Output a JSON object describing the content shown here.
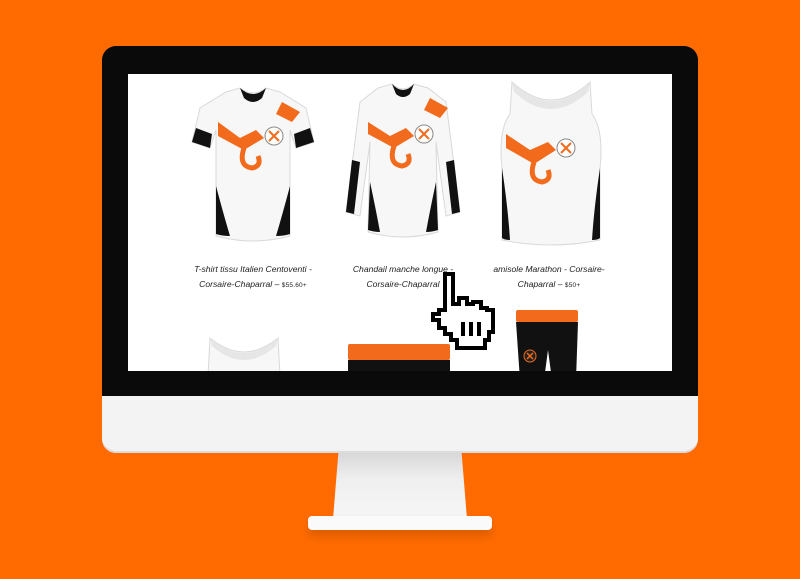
{
  "colors": {
    "background": "#ff6b00",
    "accent": "#f26a1b",
    "garment": "#f7f7f7",
    "trim": "#111111"
  },
  "products": [
    {
      "name_line1": "T-shirt tissu Italien Centoventi -",
      "name_line2": "Corsaire-Chaparral",
      "separator": "–",
      "price": "$55.60+"
    },
    {
      "name_line1": "Chandail manche longue -",
      "name_line2": "Corsaire-Chaparral"
    },
    {
      "name_line1": "amisole Marathon - Corsaire-",
      "name_line2": "Chaparral",
      "separator": "–",
      "price": "$50+"
    }
  ],
  "icons": {
    "cursor": "pointer-hand-cursor-icon",
    "logo": "crossed-swords-logo-icon"
  }
}
